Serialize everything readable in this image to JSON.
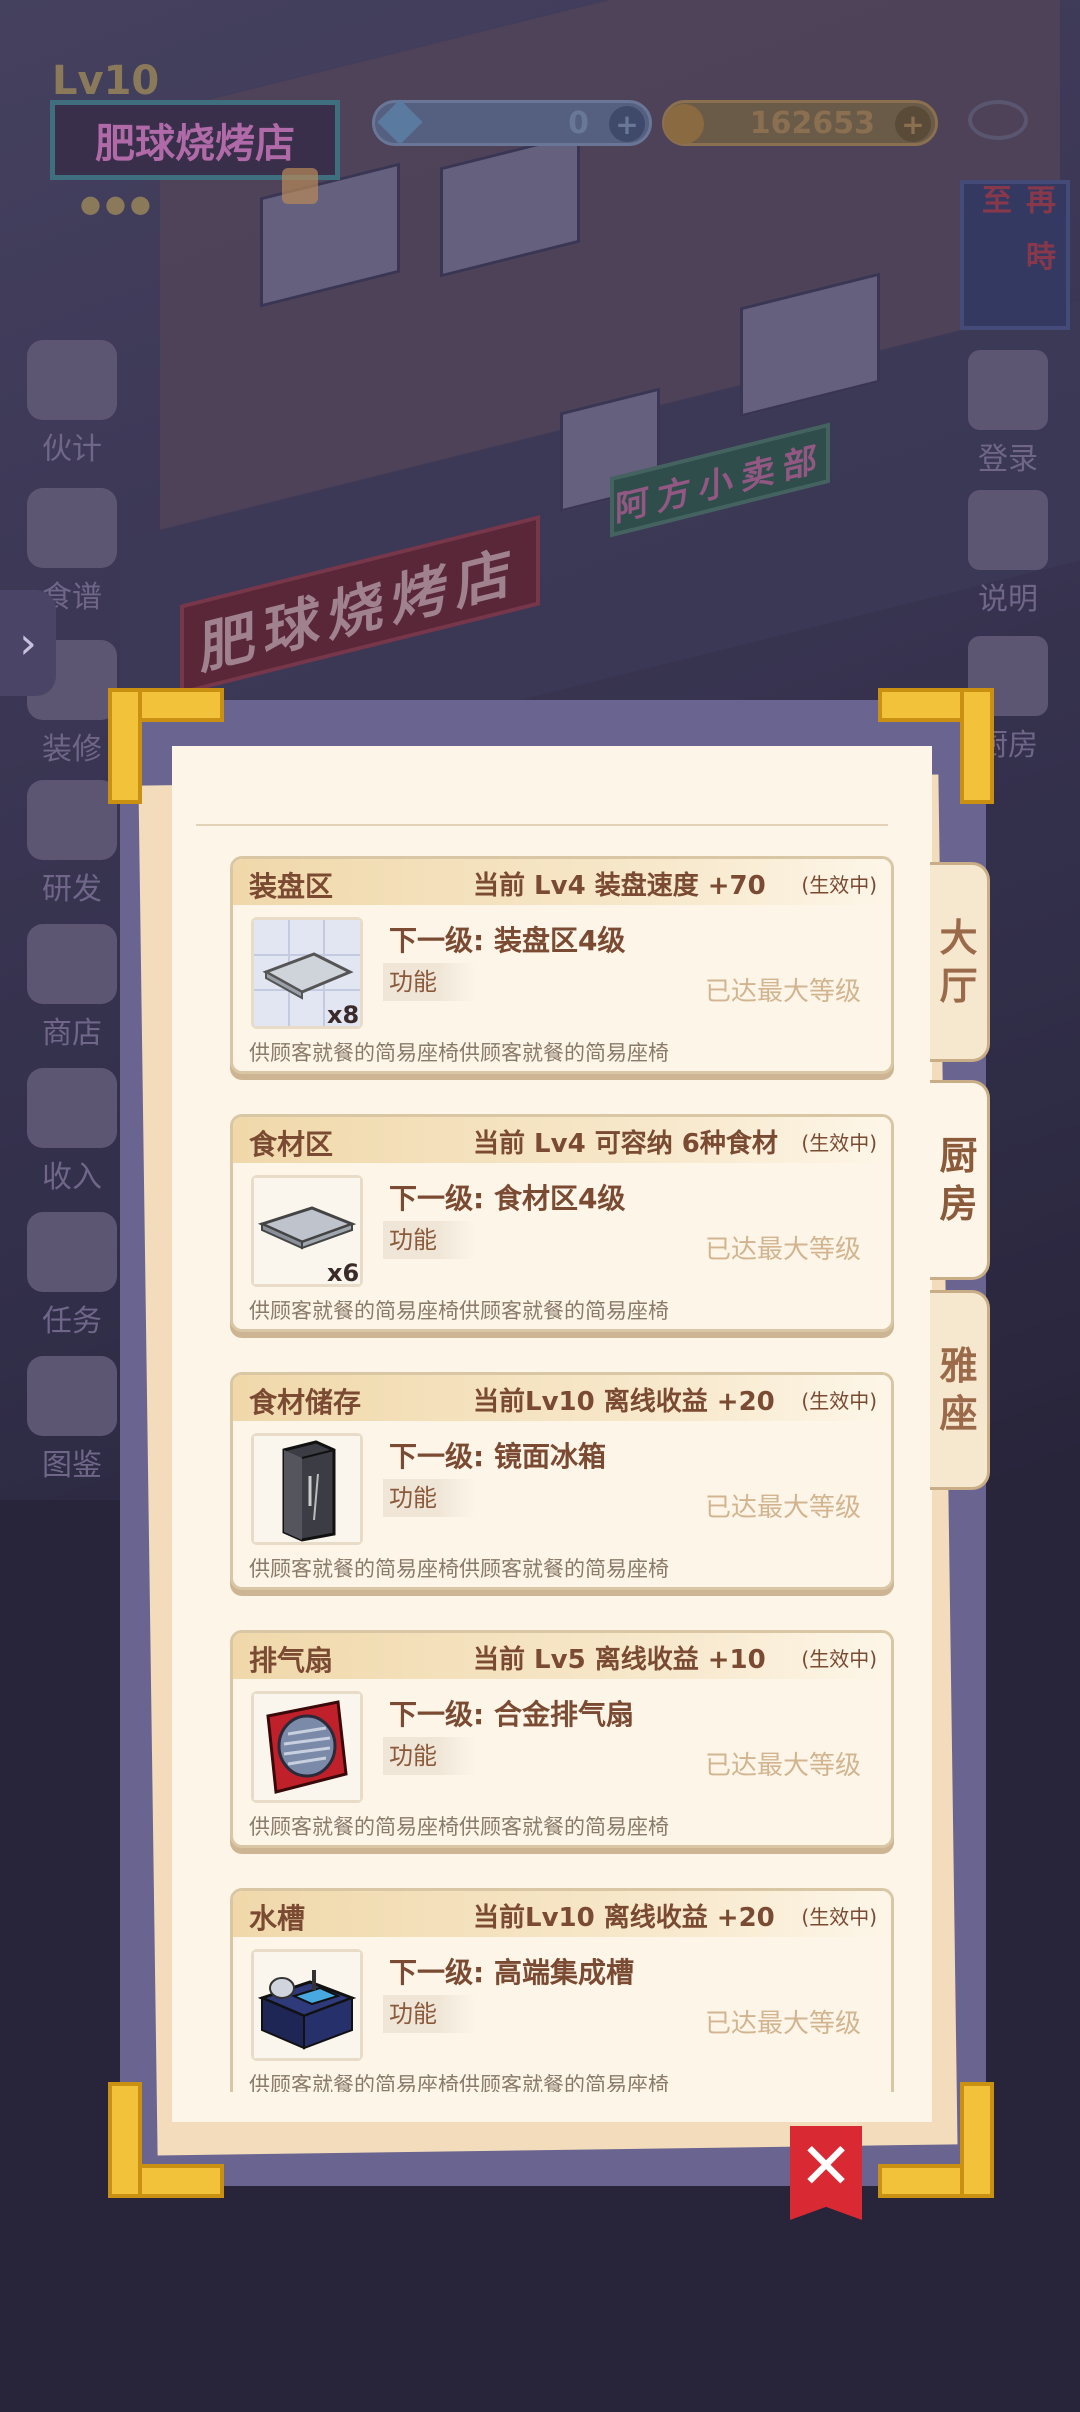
{
  "hud": {
    "level": "Lv10",
    "shop_name": "肥球烧烤店",
    "dots": "●●●",
    "gems": "0",
    "coins": "162653",
    "plus": "+"
  },
  "left_menu": [
    "伙计",
    "食谱",
    "装修",
    "研发",
    "商店",
    "收入",
    "任务",
    "图鉴"
  ],
  "right_menu": [
    "登录",
    "说明",
    "厨房"
  ],
  "scene_signs": {
    "main": "肥球烧烤店",
    "neighbor": "阿方小卖部",
    "side": "再 時 至"
  },
  "drawer_arrow": "›",
  "tabs": {
    "hall": "大厅",
    "kitchen": "厨房",
    "private_room": "雅座"
  },
  "cards": [
    {
      "name": "装盘区",
      "current": "当前 Lv4  装盘速度 +70",
      "status": "(生效中)",
      "next": "下一级: 装盘区4级",
      "func": "功能",
      "max": "已达最大等级",
      "qty": "x8",
      "icon": "plating-tray-icon",
      "desc": "供顾客就餐的简易座椅供顾客就餐的简易座椅"
    },
    {
      "name": "食材区",
      "current": "当前 Lv4  可容纳 6种食材",
      "status": "(生效中)",
      "next": "下一级: 食材区4级",
      "func": "功能",
      "max": "已达最大等级",
      "qty": "x6",
      "icon": "ingredient-tray-icon",
      "desc": "供顾客就餐的简易座椅供顾客就餐的简易座椅"
    },
    {
      "name": "食材储存",
      "current": "当前Lv10 离线收益 +20",
      "status": "(生效中)",
      "next": "下一级: 镜面冰箱",
      "func": "功能",
      "max": "已达最大等级",
      "qty": "",
      "icon": "fridge-icon",
      "desc": "供顾客就餐的简易座椅供顾客就餐的简易座椅"
    },
    {
      "name": "排气扇",
      "current": "当前 Lv5  离线收益 +10",
      "status": "(生效中)",
      "next": "下一级: 合金排气扇",
      "func": "功能",
      "max": "已达最大等级",
      "qty": "",
      "icon": "exhaust-fan-icon",
      "desc": "供顾客就餐的简易座椅供顾客就餐的简易座椅"
    },
    {
      "name": "水槽",
      "current": "当前Lv10 离线收益 +20",
      "status": "(生效中)",
      "next": "下一级: 高端集成槽",
      "func": "功能",
      "max": "已达最大等级",
      "qty": "",
      "icon": "sink-icon",
      "desc": "供顾客就餐的简易座椅供顾客就餐的简易座椅"
    }
  ],
  "close": "✕",
  "colors": {
    "panel": "#6a6490",
    "paper": "#fdf6e8",
    "accent_gold": "#f2c23a",
    "close_red": "#d92a34",
    "text_brown": "#7a4a32",
    "max_text": "#d2b590"
  }
}
